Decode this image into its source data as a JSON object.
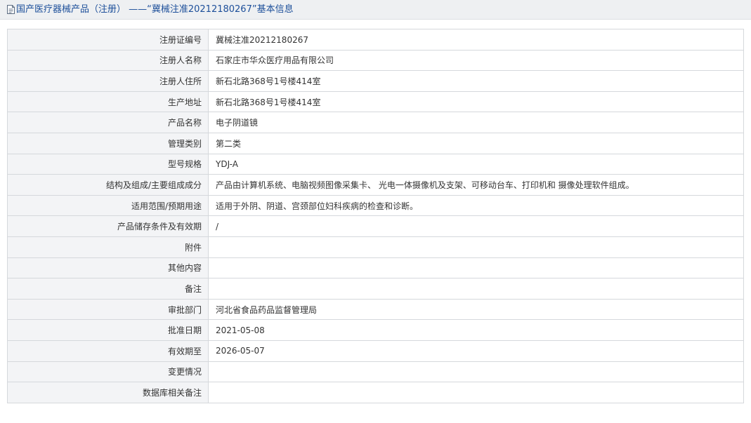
{
  "header": {
    "title": "国产医疗器械产品（注册） ——“冀械注准20212180267”基本信息",
    "icon": "document-icon",
    "title_color": "#1d4f9a"
  },
  "rows": [
    {
      "label": "注册证编号",
      "value": "冀械注准20212180267"
    },
    {
      "label": "注册人名称",
      "value": "石家庄市华众医疗用品有限公司"
    },
    {
      "label": "注册人住所",
      "value": "新石北路368号1号楼414室"
    },
    {
      "label": "生产地址",
      "value": "新石北路368号1号楼414室"
    },
    {
      "label": "产品名称",
      "value": "电子阴道镜"
    },
    {
      "label": "管理类别",
      "value": "第二类"
    },
    {
      "label": "型号规格",
      "value": "YDJ-A"
    },
    {
      "label": "结构及组成/主要组成成分",
      "value": "产品由计算机系统、电脑视频图像采集卡、 光电一体摄像机及支架、可移动台车、打印机和 摄像处理软件组成。"
    },
    {
      "label": "适用范围/预期用途",
      "value": "适用于外阴、阴道、宫颈部位妇科疾病的检查和诊断。"
    },
    {
      "label": "产品储存条件及有效期",
      "value": "/"
    },
    {
      "label": "附件",
      "value": ""
    },
    {
      "label": "其他内容",
      "value": ""
    },
    {
      "label": "备注",
      "value": ""
    },
    {
      "label": "审批部门",
      "value": "河北省食品药品监督管理局"
    },
    {
      "label": "批准日期",
      "value": "2021-05-08"
    },
    {
      "label": "有效期至",
      "value": "2026-05-07"
    },
    {
      "label": "变更情况",
      "value": ""
    },
    {
      "label": "数据库相关备注",
      "value": ""
    }
  ]
}
